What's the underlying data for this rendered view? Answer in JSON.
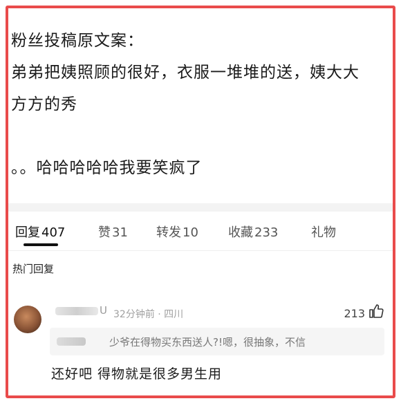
{
  "post": {
    "lines": [
      "粉丝投稿原文案：",
      "弟弟把姨照顾的很好，衣服一堆堆的送，姨大大",
      "方方的秀",
      "",
      "。。哈哈哈哈哈我要笑疯了"
    ]
  },
  "tabs": [
    {
      "label": "回复",
      "count": "407",
      "active": true
    },
    {
      "label": "赞",
      "count": "31",
      "active": false
    },
    {
      "label": "转发",
      "count": "10",
      "active": false
    },
    {
      "label": "收藏",
      "count": "233",
      "active": false
    },
    {
      "label": "礼物",
      "count": "",
      "active": false
    }
  ],
  "hot_label": "热门回复",
  "comment": {
    "username_suffix": "U",
    "meta": "32分钟前 · 四川",
    "likes": "213",
    "quote_text": "少爷在得物买东西送人?!嗯，很抽象，不信",
    "reply": "还好吧 得物就是很多男生用"
  },
  "colors": {
    "frame": "#e94b4b",
    "divider": "#f3f3f3"
  },
  "icons": {
    "like": "thumbs-up-icon"
  }
}
